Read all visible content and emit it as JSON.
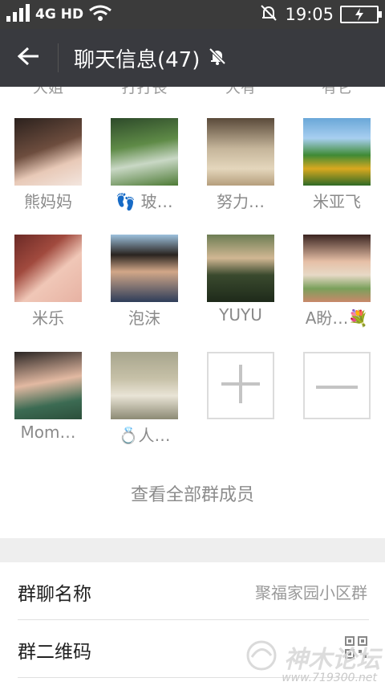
{
  "status_bar": {
    "network_label": "4G",
    "hd_label": "HD",
    "time": "19:05"
  },
  "header": {
    "title": "聊天信息(47)",
    "icons": [
      "back-arrow-icon",
      "mute-bell-icon"
    ]
  },
  "members_partial_row": [
    "大姐",
    "打打丧",
    "大有",
    "有它"
  ],
  "members": [
    {
      "name": "熊妈妈",
      "avatar_color": "#5a4236"
    },
    {
      "name": "👣 玻…",
      "avatar_color": "#4f7b3c"
    },
    {
      "name": "努力…",
      "avatar_color": "#b8a37c"
    },
    {
      "name": "米亚飞",
      "avatar_color": "#3f8a35"
    },
    {
      "name": "米乐",
      "avatar_color": "#7a3c2e"
    },
    {
      "name": "泡沫",
      "avatar_color": "#4c6a8c"
    },
    {
      "name": "YUYU",
      "avatar_color": "#6d7d54"
    },
    {
      "name": "A盼…💐",
      "avatar_color": "#c9886a"
    },
    {
      "name": "Mom…",
      "avatar_color": "#3c6b53"
    },
    {
      "name": "💍人…",
      "avatar_color": "#a7a58d"
    }
  ],
  "actions": {
    "add_icon": "plus-icon",
    "remove_icon": "minus-icon"
  },
  "view_all_label": "查看全部群成员",
  "settings": [
    {
      "label": "群聊名称",
      "value": "聚福家园小区群"
    },
    {
      "label": "群二维码",
      "value": ""
    }
  ],
  "watermark": {
    "text": "神木论坛",
    "url": "www.719300.net"
  },
  "colors": {
    "title_bar": "#393a3f",
    "status_bar": "#3b3b3b",
    "band": "#eeeeee"
  }
}
